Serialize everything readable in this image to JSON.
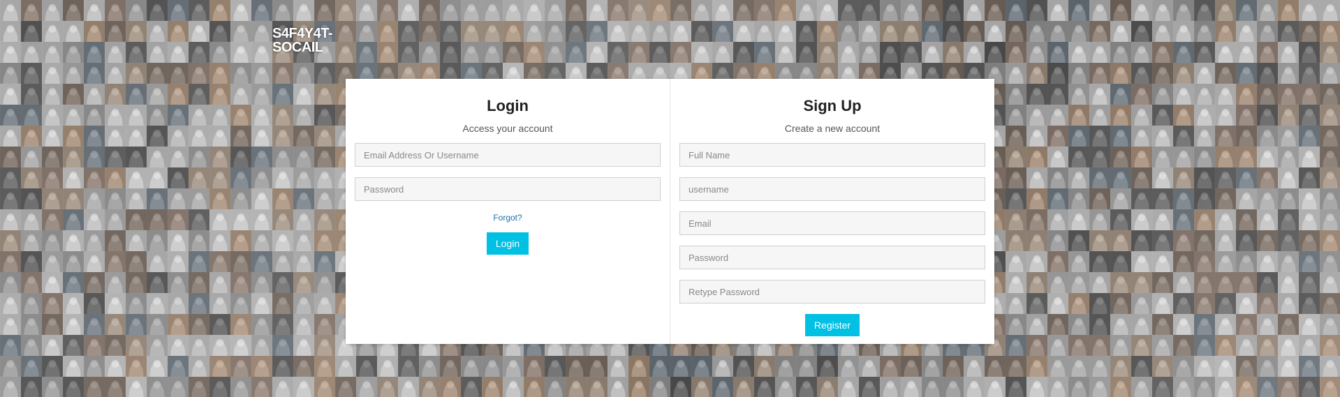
{
  "brand": {
    "name": "S4F4Y4T-SOCAIL"
  },
  "login": {
    "title": "Login",
    "subtitle": "Access your account",
    "email_placeholder": "Email Address Or Username",
    "password_placeholder": "Password",
    "forgot_label": "Forgot?",
    "submit_label": "Login"
  },
  "signup": {
    "title": "Sign Up",
    "subtitle": "Create a new account",
    "fullname_placeholder": "Full Name",
    "username_placeholder": "username",
    "email_placeholder": "Email",
    "password_placeholder": "Password",
    "retype_placeholder": "Retype Password",
    "submit_label": "Register"
  },
  "colors": {
    "accent": "#00c0e4",
    "link": "#1c6ea4",
    "card_bg": "#ffffff"
  }
}
